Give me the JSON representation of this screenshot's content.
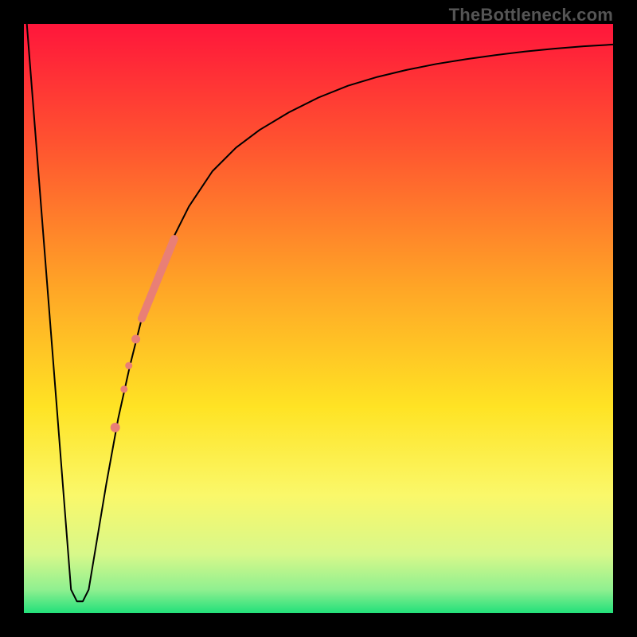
{
  "watermark": "TheBottleneck.com",
  "chart_data": {
    "type": "line",
    "title": "",
    "xlabel": "",
    "ylabel": "",
    "xlim": [
      0,
      100
    ],
    "ylim": [
      0,
      100
    ],
    "axes_visible": false,
    "grid": false,
    "background_gradient": {
      "direction": "vertical",
      "stops": [
        {
          "pos": 0.0,
          "color": "#ff163b"
        },
        {
          "pos": 0.2,
          "color": "#ff5230"
        },
        {
          "pos": 0.45,
          "color": "#ffa626"
        },
        {
          "pos": 0.65,
          "color": "#ffe324"
        },
        {
          "pos": 0.8,
          "color": "#faf86a"
        },
        {
          "pos": 0.9,
          "color": "#d8f88a"
        },
        {
          "pos": 0.96,
          "color": "#90f090"
        },
        {
          "pos": 1.0,
          "color": "#22e07a"
        }
      ]
    },
    "series": [
      {
        "name": "curve",
        "color": "#000000",
        "stroke_width": 2,
        "x": [
          0.5,
          3,
          5.5,
          8,
          9,
          10,
          11,
          12,
          14,
          16,
          18,
          20,
          22,
          25,
          28,
          32,
          36,
          40,
          45,
          50,
          55,
          60,
          65,
          70,
          75,
          80,
          85,
          90,
          95,
          100
        ],
        "y": [
          100,
          68,
          36,
          4,
          2,
          2,
          4,
          10,
          22,
          33,
          42,
          50,
          56,
          63,
          69,
          75,
          79,
          82,
          85,
          87.5,
          89.5,
          91,
          92.2,
          93.2,
          94,
          94.7,
          95.3,
          95.8,
          96.2,
          96.5
        ]
      }
    ],
    "markers": [
      {
        "name": "segment",
        "type": "line",
        "color": "#e97f76",
        "stroke_width": 10,
        "stroke_linecap": "round",
        "points": [
          {
            "x": 20.0,
            "y": 50.0
          },
          {
            "x": 25.5,
            "y": 63.5
          }
        ]
      },
      {
        "name": "dot-1",
        "type": "circle",
        "color": "#e97f76",
        "r": 5.5,
        "x": 19.0,
        "y": 46.5
      },
      {
        "name": "dot-2",
        "type": "circle",
        "color": "#e97f76",
        "r": 4.5,
        "x": 17.8,
        "y": 42.0
      },
      {
        "name": "dot-3",
        "type": "circle",
        "color": "#e97f76",
        "r": 4.5,
        "x": 17.0,
        "y": 38.0
      },
      {
        "name": "dot-4",
        "type": "circle",
        "color": "#e97f76",
        "r": 6.0,
        "x": 15.5,
        "y": 31.5
      }
    ]
  }
}
